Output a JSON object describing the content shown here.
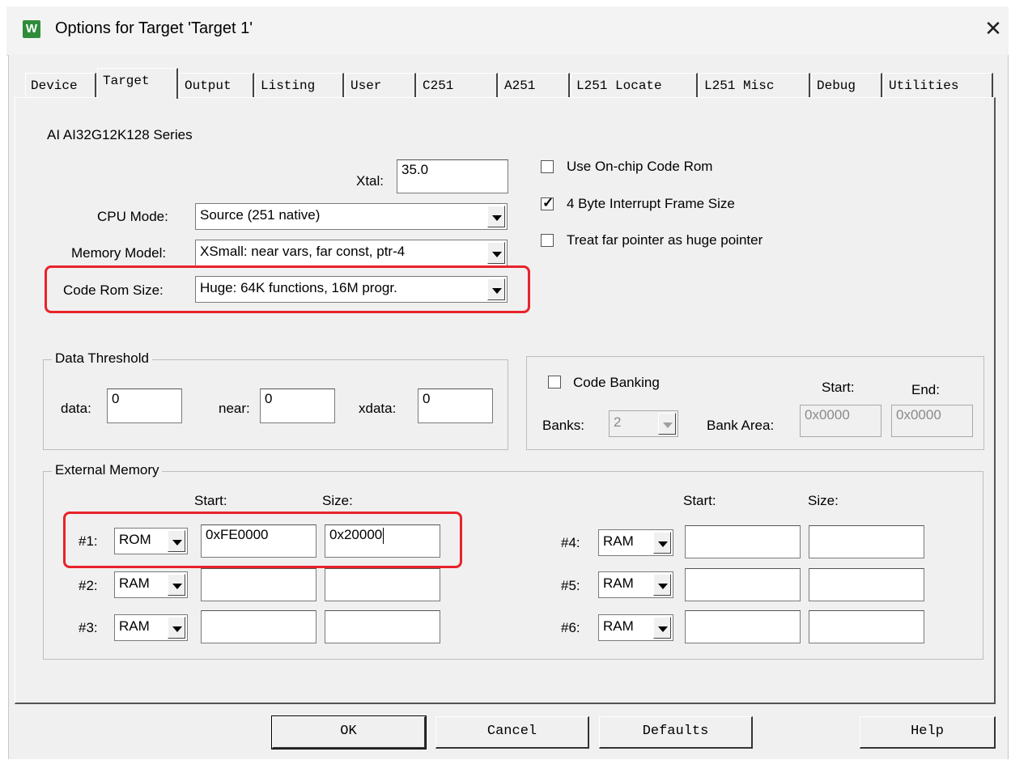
{
  "window": {
    "title": "Options for Target 'Target 1'",
    "app_icon": "W",
    "close_glyph": "✕"
  },
  "tabs": [
    "Device",
    "Target",
    "Output",
    "Listing",
    "User",
    "C251",
    "A251",
    "L251 Locate",
    "L251 Misc",
    "Debug",
    "Utilities"
  ],
  "active_tab": "Target",
  "device_name": "AI AI32G12K128 Series",
  "xtal": {
    "label": "Xtal:",
    "value": "35.0"
  },
  "cpu_mode": {
    "label": "CPU Mode:",
    "value": "Source (251 native)"
  },
  "memory_model": {
    "label": "Memory Model:",
    "value": "XSmall: near vars, far const, ptr-4"
  },
  "code_rom_size": {
    "label": "Code Rom Size:",
    "value": "Huge: 64K functions, 16M progr."
  },
  "options": [
    {
      "label": "Use On-chip Code Rom",
      "checked": false
    },
    {
      "label": "4 Byte Interrupt Frame Size",
      "checked": true
    },
    {
      "label": "Treat far pointer as huge pointer",
      "checked": false
    }
  ],
  "data_threshold": {
    "title": "Data Threshold",
    "data_label": "data:",
    "data_value": "0",
    "near_label": "near:",
    "near_value": "0",
    "xdata_label": "xdata:",
    "xdata_value": "0"
  },
  "code_banking": {
    "label": "Code Banking",
    "checked": false,
    "banks_label": "Banks:",
    "banks_value": "2",
    "bank_area_label": "Bank Area:",
    "start_label": "Start:",
    "start_value": "0x0000",
    "end_label": "End:",
    "end_value": "0x0000"
  },
  "external_memory": {
    "title": "External Memory",
    "start_header": "Start:",
    "size_header": "Size:",
    "rows": [
      {
        "label": "#1:",
        "type": "ROM",
        "start": "0xFE0000",
        "size": "0x20000"
      },
      {
        "label": "#2:",
        "type": "RAM",
        "start": "",
        "size": ""
      },
      {
        "label": "#3:",
        "type": "RAM",
        "start": "",
        "size": ""
      },
      {
        "label": "#4:",
        "type": "RAM",
        "start": "",
        "size": ""
      },
      {
        "label": "#5:",
        "type": "RAM",
        "start": "",
        "size": ""
      },
      {
        "label": "#6:",
        "type": "RAM",
        "start": "",
        "size": ""
      }
    ]
  },
  "buttons": {
    "ok": "OK",
    "cancel": "Cancel",
    "defaults": "Defaults",
    "help": "Help"
  },
  "highlight_color": "#e8232a"
}
